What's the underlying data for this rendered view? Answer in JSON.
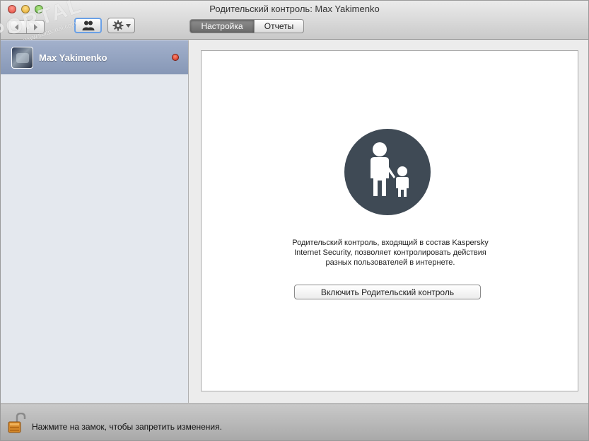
{
  "window": {
    "title": "Родительский контроль: Max Yakimenko"
  },
  "toolbar": {
    "back_icon": "chevron-left-icon",
    "forward_icon": "chevron-right-icon",
    "users_icon": "users-icon",
    "gear_icon": "gear-icon",
    "tabs": [
      {
        "label": "Настройка",
        "active": true
      },
      {
        "label": "Отчеты",
        "active": false
      }
    ]
  },
  "watermark": {
    "text": "PORTAL",
    "sub": "www.softportal.com"
  },
  "sidebar": {
    "users": [
      {
        "name": "Max Yakimenko",
        "status_color": "#d9341f"
      }
    ]
  },
  "main": {
    "hero_icon": "parent-child-icon",
    "hero_color": "#3f4a55",
    "description_lines": [
      "Родительский контроль, входящий в состав Kaspersky",
      "Internet Security, позволяет контролировать действия",
      "разных пользователей в интернете."
    ],
    "enable_button": "Включить Родительский контроль"
  },
  "statusbar": {
    "lock_icon": "unlocked-padlock-icon",
    "text": "Нажмите на замок, чтобы запретить изменения."
  }
}
